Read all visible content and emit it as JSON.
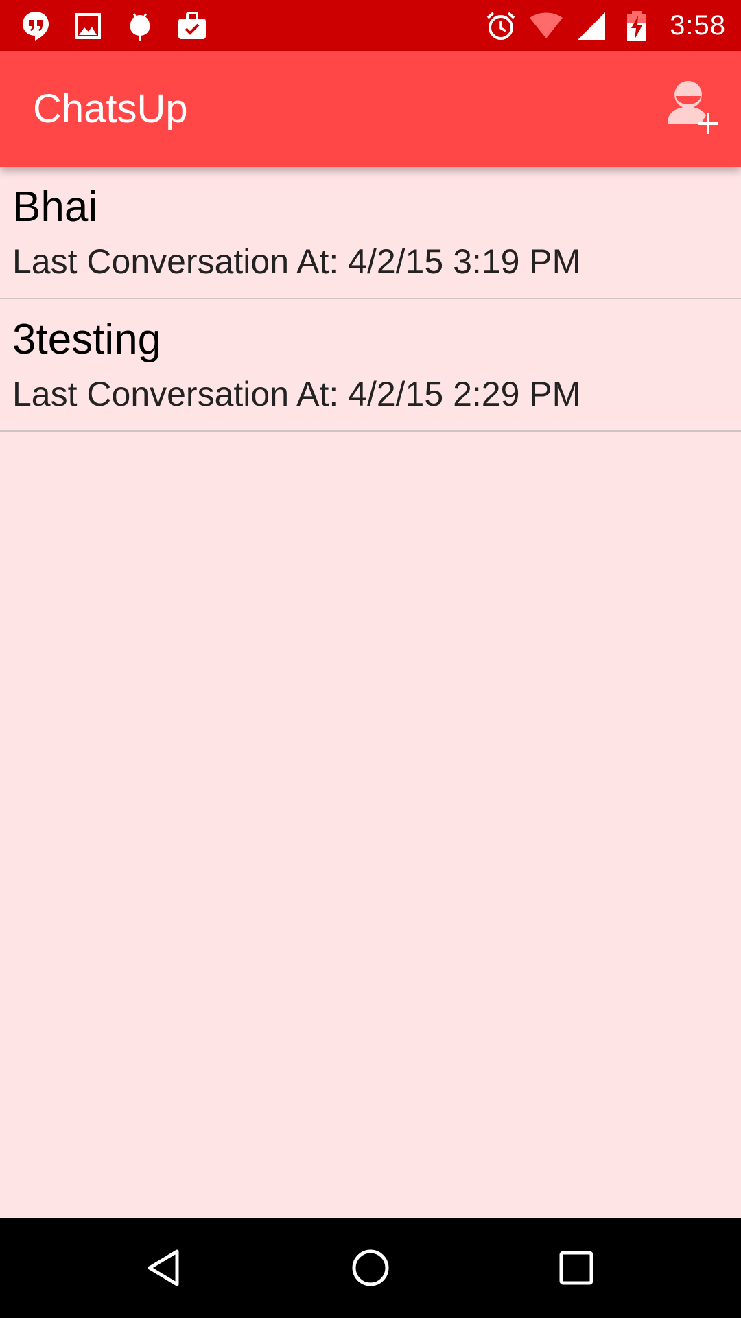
{
  "status_bar": {
    "time": "3:58",
    "left_icons": [
      "hangouts-icon",
      "image-icon",
      "android-icon",
      "briefcase-check-icon"
    ],
    "right_icons": [
      "alarm-icon",
      "wifi-icon",
      "signal-icon",
      "battery-charging-icon"
    ]
  },
  "app_bar": {
    "title": "ChatsUp",
    "action_icon": "add-contact-icon"
  },
  "conversations": [
    {
      "name": "Bhai",
      "last_conversation": "Last Conversation At: 4/2/15 3:19 PM"
    },
    {
      "name": "3testing",
      "last_conversation": "Last Conversation At: 4/2/15 2:29 PM"
    }
  ],
  "nav_bar": {
    "icons": [
      "back-icon",
      "home-icon",
      "recents-icon"
    ]
  },
  "colors": {
    "status_bar": "#cc0000",
    "app_bar": "#ff4747",
    "background": "#ffe4e6",
    "nav_bar": "#000000"
  }
}
